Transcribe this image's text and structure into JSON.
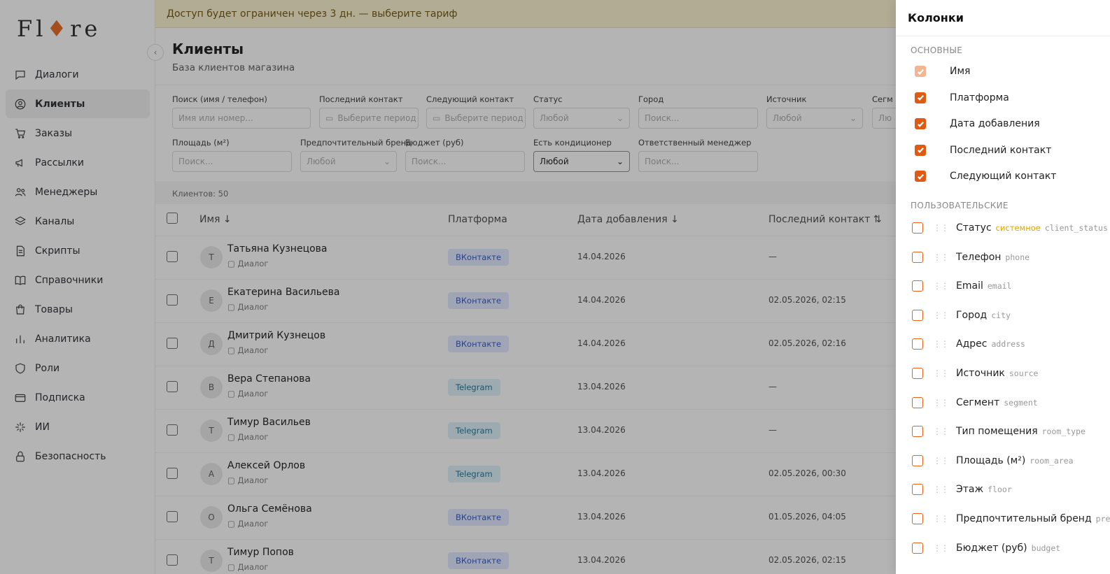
{
  "banner": "Доступ будет ограничен через 3 дн. — выберите тариф",
  "logo": {
    "pre": "Fl",
    "flame": "♦",
    "post": "re"
  },
  "nav": [
    {
      "label": "Диалоги",
      "icon": "chat-icon"
    },
    {
      "label": "Клиенты",
      "icon": "user-circle-icon",
      "active": true
    },
    {
      "label": "Заказы",
      "icon": "cart-icon"
    },
    {
      "label": "Рассылки",
      "icon": "megaphone-icon"
    },
    {
      "label": "Менеджеры",
      "icon": "users-icon"
    },
    {
      "label": "Каналы",
      "icon": "layers-icon"
    },
    {
      "label": "Скрипты",
      "icon": "document-icon"
    },
    {
      "label": "Справочники",
      "icon": "book-icon"
    },
    {
      "label": "Товары",
      "icon": "bag-icon"
    },
    {
      "label": "Аналитика",
      "icon": "chart-icon"
    },
    {
      "label": "Роли",
      "icon": "shield-icon"
    },
    {
      "label": "Подписка",
      "icon": "card-icon"
    },
    {
      "label": "ИИ",
      "icon": "sparkle-icon"
    },
    {
      "label": "Безопасность",
      "icon": "lock-icon"
    }
  ],
  "page": {
    "title": "Клиенты",
    "subtitle": "База клиентов магазина"
  },
  "filters": {
    "search_label": "Поиск (имя / телефон)",
    "search_placeholder": "Имя или номер...",
    "last_label": "Последний контакт",
    "last_placeholder": "Выберите период",
    "next_label": "Следующий контакт",
    "next_placeholder": "Выберите период",
    "status_label": "Статус",
    "status_value": "Любой",
    "city_label": "Город",
    "city_placeholder": "Поиск...",
    "source_label": "Источник",
    "source_value": "Любой",
    "segment_label": "Сегм",
    "segment_value": "Лю",
    "area_label": "Площадь (м²)",
    "area_placeholder": "Поиск...",
    "brand_label": "Предпочтительный бренд",
    "brand_value": "Любой",
    "budget_label": "Бюджет (руб)",
    "budget_placeholder": "Поиск...",
    "ac_label": "Есть кондиционер",
    "ac_value": "Любой",
    "manager_label": "Ответственный менеджер",
    "manager_placeholder": "Поиск..."
  },
  "count": "Клиентов: 50",
  "columns": {
    "name": "Имя ↓",
    "platform": "Платформа",
    "added": "Дата добавления ↓",
    "last": "Последний контакт ⇅"
  },
  "dialog_label": "Диалог",
  "rows": [
    {
      "initial": "Т",
      "name": "Татьяна Кузнецова",
      "platform": "ВКонтакте",
      "kind": "vk",
      "date": "14.04.2026",
      "last": "—"
    },
    {
      "initial": "Е",
      "name": "Екатерина Васильева",
      "platform": "ВКонтакте",
      "kind": "vk",
      "date": "14.04.2026",
      "last": "02.05.2026, 02:15"
    },
    {
      "initial": "Д",
      "name": "Дмитрий Кузнецов",
      "platform": "ВКонтакте",
      "kind": "vk",
      "date": "14.04.2026",
      "last": "02.05.2026, 02:16"
    },
    {
      "initial": "В",
      "name": "Вера Степанова",
      "platform": "Telegram",
      "kind": "tg",
      "date": "13.04.2026",
      "last": "—"
    },
    {
      "initial": "Т",
      "name": "Тимур Васильев",
      "platform": "Telegram",
      "kind": "tg",
      "date": "13.04.2026",
      "last": "—"
    },
    {
      "initial": "А",
      "name": "Алексей Орлов",
      "platform": "Telegram",
      "kind": "tg",
      "date": "13.04.2026",
      "last": "02.05.2026, 00:30"
    },
    {
      "initial": "О",
      "name": "Ольга Семёнова",
      "platform": "ВКонтакте",
      "kind": "vk",
      "date": "13.04.2026",
      "last": "01.05.2026, 04:05"
    },
    {
      "initial": "Т",
      "name": "Тимур Попов",
      "platform": "ВКонтакте",
      "kind": "vk",
      "date": "13.04.2026",
      "last": "02.05.2026, 02:15"
    }
  ],
  "drawer": {
    "title": "Колонки",
    "basic_title": "ОСНОВНЫЕ",
    "basic": [
      {
        "label": "Имя",
        "state": "dis"
      },
      {
        "label": "Платформа",
        "state": "on"
      },
      {
        "label": "Дата добавления",
        "state": "on"
      },
      {
        "label": "Последний контакт",
        "state": "on"
      },
      {
        "label": "Следующий контакт",
        "state": "on"
      }
    ],
    "custom_title": "ПОЛЬЗОВАТЕЛЬСКИЕ",
    "custom": [
      {
        "label": "Статус",
        "sys": "системное",
        "key": "client_status"
      },
      {
        "label": "Телефон",
        "key": "phone"
      },
      {
        "label": "Email",
        "key": "email"
      },
      {
        "label": "Город",
        "key": "city"
      },
      {
        "label": "Адрес",
        "key": "address"
      },
      {
        "label": "Источник",
        "key": "source"
      },
      {
        "label": "Сегмент",
        "key": "segment"
      },
      {
        "label": "Тип помещения",
        "key": "room_type"
      },
      {
        "label": "Площадь (м²)",
        "key": "room_area"
      },
      {
        "label": "Этаж",
        "key": "floor"
      },
      {
        "label": "Предпочтительный бренд",
        "key": "preferred"
      },
      {
        "label": "Бюджет (руб)",
        "key": "budget"
      }
    ]
  }
}
